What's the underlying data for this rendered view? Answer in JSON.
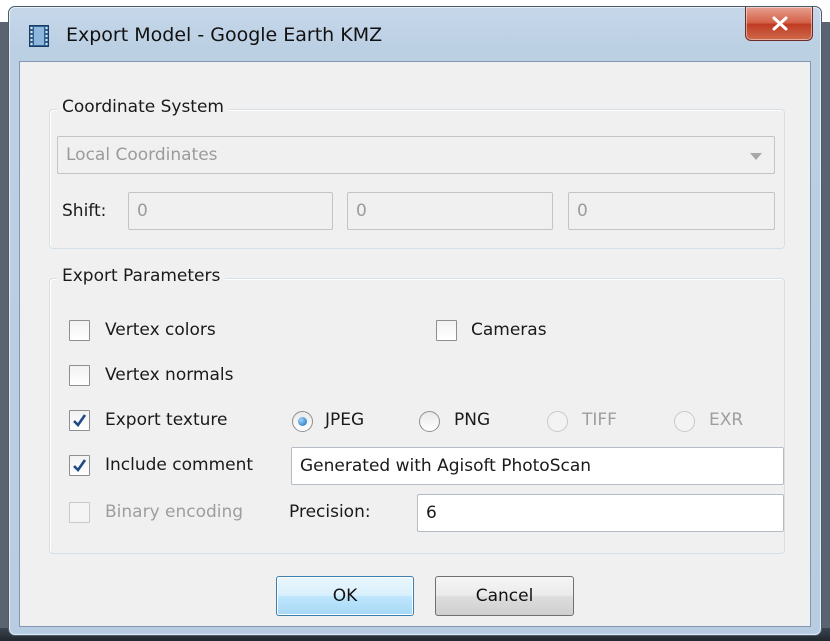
{
  "window": {
    "title": "Export Model - Google Earth KMZ"
  },
  "icons": {
    "app": "film-strip-icon",
    "close": "close-x-icon",
    "combo": "chevron-down-icon"
  },
  "colors": {
    "title_bar": "#bcd0e4",
    "close_button": "#c94a31",
    "client_background": "#f0f0f0",
    "radio_selected": "#1b67b3",
    "default_button_border": "#3c7fb1"
  },
  "coordinate_system": {
    "title": "Coordinate System",
    "system_value": "Local Coordinates",
    "shift_label": "Shift:",
    "shift_values": [
      "0",
      "0",
      "0"
    ]
  },
  "export_parameters": {
    "title": "Export Parameters",
    "vertex_colors": {
      "label": "Vertex colors",
      "checked": false
    },
    "cameras": {
      "label": "Cameras",
      "checked": false
    },
    "vertex_normals": {
      "label": "Vertex normals",
      "checked": false
    },
    "export_texture": {
      "label": "Export texture",
      "checked": true
    },
    "texture_formats": [
      {
        "label": "JPEG",
        "selected": true,
        "enabled": true
      },
      {
        "label": "PNG",
        "selected": false,
        "enabled": true
      },
      {
        "label": "TIFF",
        "selected": false,
        "enabled": false
      },
      {
        "label": "EXR",
        "selected": false,
        "enabled": false
      }
    ],
    "include_comment": {
      "label": "Include comment",
      "checked": true
    },
    "comment_value": "Generated with Agisoft PhotoScan",
    "binary_encoding": {
      "label": "Binary encoding",
      "checked": false,
      "enabled": false
    },
    "precision_label": "Precision:",
    "precision_value": "6"
  },
  "buttons": {
    "ok": "OK",
    "cancel": "Cancel"
  }
}
